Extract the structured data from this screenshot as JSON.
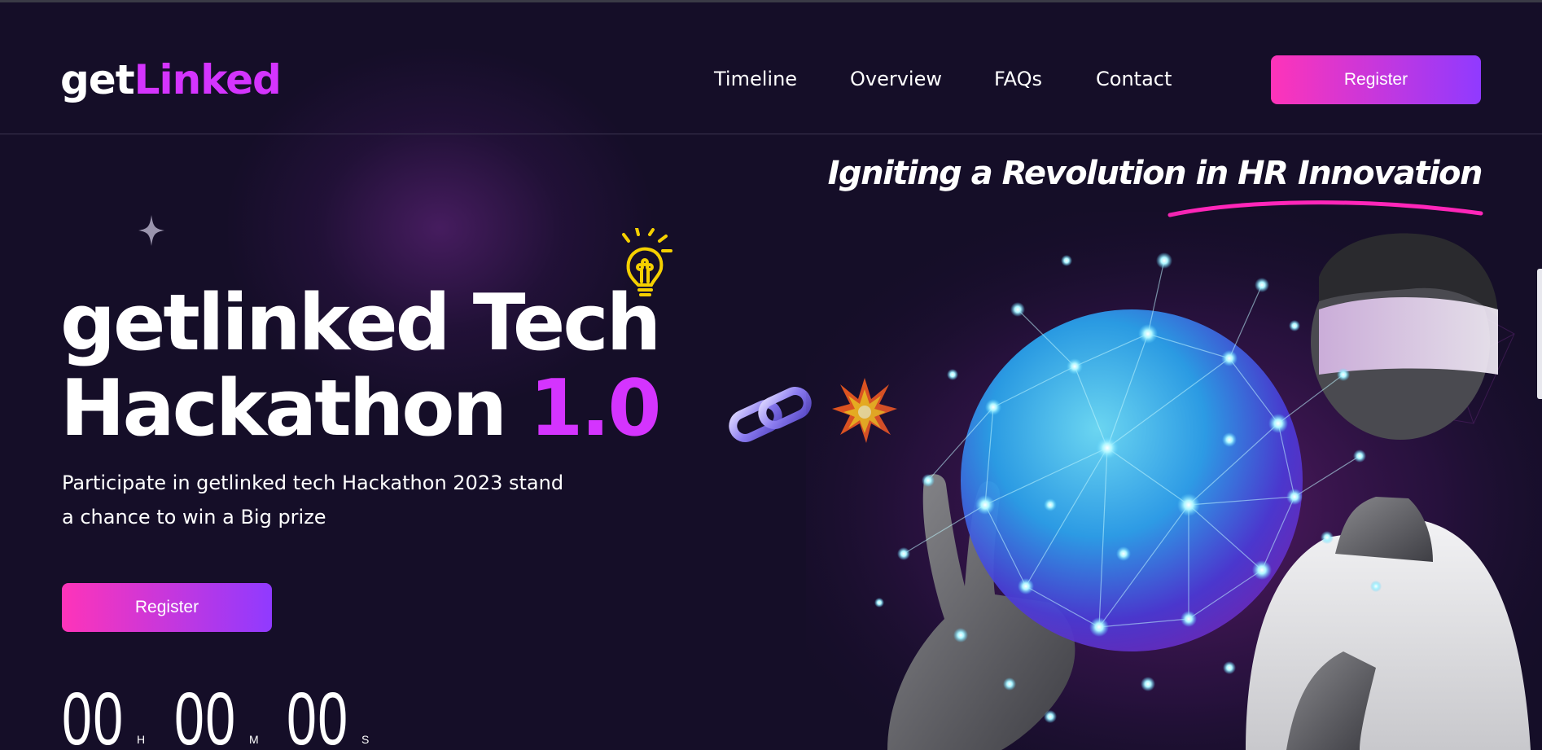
{
  "header": {
    "logo_part1": "get",
    "logo_part2": "Linked",
    "nav": [
      "Timeline",
      "Overview",
      "FAQs",
      "Contact"
    ],
    "register_label": "Register"
  },
  "hero": {
    "tagline": "Igniting a Revolution in HR Innovation",
    "title_line1": "getlinked Tech",
    "title_line2": "Hackathon",
    "title_accent": "1.0",
    "subtitle_line1": "Participate in getlinked tech Hackathon 2023 stand",
    "subtitle_line2": "a chance to win a Big prize",
    "register_label": "Register",
    "timer": {
      "hours": "00",
      "hours_unit": "H",
      "minutes": "00",
      "minutes_unit": "M",
      "seconds": "00",
      "seconds_unit": "S"
    }
  },
  "icons": {
    "sparkle": "sparkle-icon",
    "bulb": "lightbulb-icon",
    "chain": "chain-link-icon",
    "burst": "collision-burst-icon"
  },
  "colors": {
    "background": "#150e28",
    "accent": "#d434fe",
    "gradient_start": "#fe34b9",
    "gradient_end": "#903aff",
    "tagline_underline": "#ff26b9",
    "bulb": "#f5d000"
  }
}
